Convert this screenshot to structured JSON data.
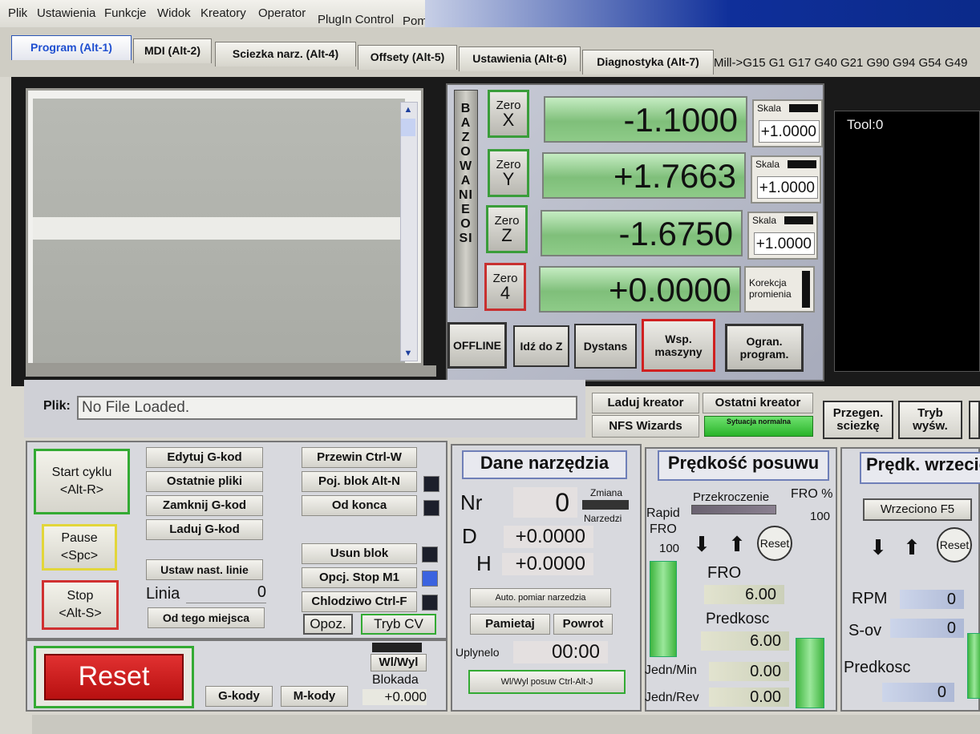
{
  "menu": [
    "Plik",
    "Ustawienia",
    "Funkcje",
    "Widok",
    "Kreatory",
    "Operator",
    "PlugIn Control",
    "Pomoc"
  ],
  "tabs": [
    "Program (Alt-1)",
    "MDI (Alt-2)",
    "Sciezka narz. (Alt-4)",
    "Offsety (Alt-5)",
    "Ustawienia (Alt-6)",
    "Diagnostyka (Alt-7)"
  ],
  "modal_line": "Mill->G15  G1 G17 G40 G21 G90 G94 G54 G49",
  "dro": {
    "bazowanie": "BAZOWANIE OSI",
    "axes": [
      {
        "zero": "Zero",
        "axis": "X",
        "value": "-1.1000",
        "scale_label": "Skala",
        "scale": "+1.0000"
      },
      {
        "zero": "Zero",
        "axis": "Y",
        "value": "+1.7663",
        "scale_label": "Skala",
        "scale": "+1.0000"
      },
      {
        "zero": "Zero",
        "axis": "Z",
        "value": "-1.6750",
        "scale_label": "Skala",
        "scale": "+1.0000"
      },
      {
        "zero": "Zero",
        "axis": "4",
        "value": "+0.0000",
        "scale_label": "Korekcja promienia",
        "scale": ""
      }
    ],
    "buttons": [
      "OFFLINE",
      "Idź do Z",
      "Dystans",
      "Wsp. maszyny",
      "Ogran. program."
    ]
  },
  "tool": {
    "label": "Tool:0"
  },
  "file": {
    "label": "Plik:",
    "value": "No File Loaded."
  },
  "wizards": {
    "laduj": "Laduj kreator",
    "ostatni": "Ostatni kreator",
    "nfs": "NFS Wizards",
    "status": "Sytuacja normalna"
  },
  "side_buttons": {
    "przegen": "Przegen. sciezkę",
    "tryb": "Tryb wyśw."
  },
  "program": {
    "start": "Start cyklu",
    "start_key": "<Alt-R>",
    "pause": "Pause",
    "pause_key": "<Spc>",
    "stop": "Stop",
    "stop_key": "<Alt-S>",
    "edytuj": "Edytuj G-kod",
    "ostatnie": "Ostatnie pliki",
    "zamknij": "Zamknij G-kod",
    "laduj": "Laduj G-kod",
    "ustaw": "Ustaw nast. linie",
    "linia_label": "Linia",
    "linia": "0",
    "od_tego": "Od tego miejsca",
    "przewin": "Przewin Ctrl-W",
    "poj": "Poj. blok Alt-N",
    "od_konca": "Od konca",
    "usun": "Usun blok",
    "opcj": "Opcj. Stop M1",
    "chlodziwo": "Chlodziwo Ctrl-F",
    "opoz": "Opoz.",
    "tryb_cv": "Tryb CV"
  },
  "reset": {
    "label": "Reset",
    "gkody": "G-kody",
    "mkody": "M-kody",
    "wlwyl": "Wl/Wyl",
    "blokada": "Blokada",
    "blokada_val": "+0.000"
  },
  "narzedzie": {
    "title": "Dane narzędzia",
    "nr_label": "Nr",
    "nr": "0",
    "zmiana": "Zmiana",
    "narzedzi": "Narzedzi",
    "d_label": "D",
    "d": "+0.0000",
    "h_label": "H",
    "h": "+0.0000",
    "auto": "Auto. pomiar narzedzia",
    "pamietaj": "Pamietaj",
    "powrot": "Powrot",
    "uplynelo": "Uplynelo",
    "czas": "00:00",
    "wlwyl_posuw": "Wl/Wyl posuw Ctrl-Alt-J"
  },
  "posuw": {
    "title": "Prędkość posuwu",
    "przekroczenie": "Przekroczenie",
    "fro_pct": "FRO %",
    "fro_pct_val": "100",
    "rapid": "Rapid",
    "rapid_fro": "FRO",
    "rapid_val": "100",
    "reset": "Reset",
    "fro": "FRO",
    "fro_val": "6.00",
    "predkosc": "Predkosc",
    "predkosc_val": "6.00",
    "jedn_min": "Jedn/Min",
    "jedn_min_val": "0.00",
    "jedn_rev": "Jedn/Rev",
    "jedn_rev_val": "0.00",
    "rapid_level": 1.0
  },
  "wrzeciono": {
    "title": "Prędk. wrzeciona",
    "wrz_btn": "Wrzeciono F5",
    "reset": "Reset",
    "rpm": "RPM",
    "rpm_val": "0",
    "sov": "S-ov",
    "sov_val": "0",
    "predkosc": "Predkosc",
    "predkosc_val": "0"
  }
}
